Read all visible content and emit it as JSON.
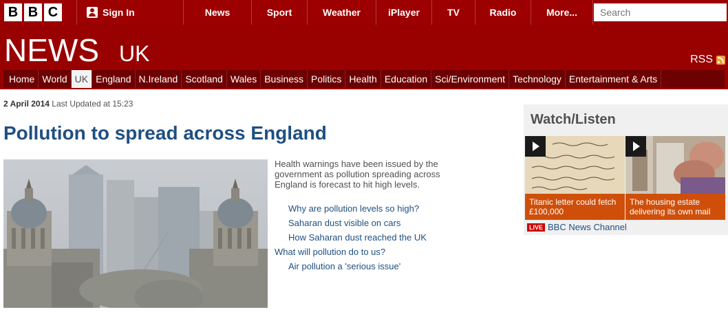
{
  "global_bar": {
    "logo_letters": [
      "B",
      "B",
      "C"
    ],
    "signin_label": "Sign In",
    "nav": [
      {
        "label": "News",
        "width": 99
      },
      {
        "label": "Sport",
        "width": 81
      },
      {
        "label": "Weather",
        "width": 100
      },
      {
        "label": "iPlayer",
        "width": 81
      },
      {
        "label": "TV",
        "width": 63
      },
      {
        "label": "Radio",
        "width": 81
      },
      {
        "label": "More...",
        "width": 90
      }
    ],
    "search_placeholder": "Search"
  },
  "news_header": {
    "title": "NEWS",
    "edition": "UK",
    "rss_label": "RSS"
  },
  "subnav": {
    "items": [
      "Home",
      "World",
      "UK",
      "England",
      "N.Ireland",
      "Scotland",
      "Wales",
      "Business",
      "Politics",
      "Health",
      "Education",
      "Sci/Environment",
      "Technology",
      "Entertainment & Arts"
    ],
    "active_index": 2
  },
  "article": {
    "date": "2 April 2014",
    "updated": "Last Updated at 15:23",
    "headline": "Pollution to spread across England",
    "summary": "Health warnings have been issued by the government as pollution spreading across England is forecast to hit high levels.",
    "links": [
      {
        "text": "Why are pollution levels so high?",
        "sub": true
      },
      {
        "text": "Saharan dust visible on cars",
        "sub": true
      },
      {
        "text": "How Saharan dust reached the UK",
        "sub": true
      },
      {
        "text": "What will pollution do to us?",
        "sub": false
      },
      {
        "text": "Air pollution a 'serious issue'",
        "sub": true
      }
    ]
  },
  "watch_listen": {
    "title": "Watch/Listen",
    "videos": [
      {
        "caption": "Titanic letter could fetch £100,000"
      },
      {
        "caption": "The housing estate delivering its own mail"
      }
    ],
    "live_badge": "LIVE",
    "live_label": "BBC News Channel"
  }
}
